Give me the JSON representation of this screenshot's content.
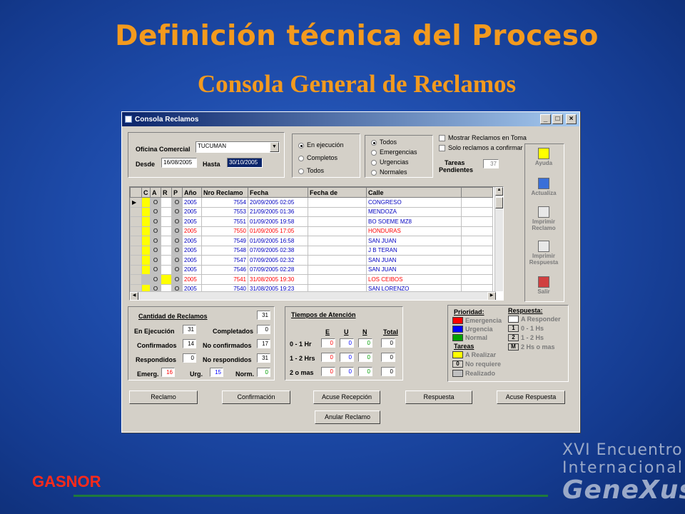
{
  "slide": {
    "title": "Definición técnica del Proceso",
    "subtitle": "Consola General de Reclamos",
    "footer_company": "GASNOR",
    "brand_line1": "XVI Encuentro",
    "brand_line2": "Internacional",
    "brand_line3": "GeneXus"
  },
  "window": {
    "title": "Consola Reclamos",
    "btn_min": "_",
    "btn_max": "□",
    "btn_close": "×"
  },
  "filters": {
    "oficina_label": "Oficina Comercial",
    "oficina_value": "TUCUMAN",
    "desde_label": "Desde",
    "desde_value": "16/08/2005",
    "hasta_label": "Hasta",
    "hasta_value": "30/10/2005",
    "estado_options": [
      "En ejecución",
      "Completos",
      "Todos"
    ],
    "tipo_options": [
      "Todos",
      "Emergencias",
      "Urgencias",
      "Normales"
    ],
    "chk_toma": "Mostrar Reclamos en Toma",
    "chk_confirmar": "Solo reclamos a confirmar",
    "tareas_label1": "Tareas",
    "tareas_label2": "Pendientes",
    "tareas_value": "37"
  },
  "side_buttons": [
    {
      "label1": "Ayuda",
      "label2": ""
    },
    {
      "label1": "Actualiza",
      "label2": ""
    },
    {
      "label1": "Imprimir",
      "label2": "Reclamo"
    },
    {
      "label1": "Imprimir",
      "label2": "Respuesta"
    },
    {
      "label1": "Salir",
      "label2": ""
    }
  ],
  "grid": {
    "headers": [
      "C",
      "A",
      "R",
      "P",
      "Año",
      "Nro Reclamo",
      "Fecha",
      "Fecha de",
      "Calle"
    ],
    "rows": [
      {
        "c": "#ffff00",
        "a": "O",
        "p": "O",
        "anio": "2005",
        "nro": "7554",
        "fecha": "20/09/2005 02:05",
        "calle": "CONGRESO",
        "color": "#0000c0"
      },
      {
        "c": "#ffff00",
        "a": "O",
        "p": "O",
        "anio": "2005",
        "nro": "7553",
        "fecha": "21/09/2005 01:36",
        "calle": "MENDOZA",
        "color": "#0000c0"
      },
      {
        "c": "#ffff00",
        "a": "O",
        "p": "O",
        "anio": "2005",
        "nro": "7551",
        "fecha": "01/09/2005 19:58",
        "calle": "BO SOEME MZ8",
        "color": "#0000c0"
      },
      {
        "c": "#ffff00",
        "a": "O",
        "p": "O",
        "anio": "2005",
        "nro": "7550",
        "fecha": "01/09/2005 17:05",
        "calle": "HONDURAS",
        "color": "#ff0000"
      },
      {
        "c": "#ffff00",
        "a": "O",
        "p": "O",
        "anio": "2005",
        "nro": "7549",
        "fecha": "01/09/2005 16:58",
        "calle": "SAN JUAN",
        "color": "#0000c0"
      },
      {
        "c": "#ffff00",
        "a": "O",
        "p": "O",
        "anio": "2005",
        "nro": "7548",
        "fecha": "07/09/2005 02:38",
        "calle": "J B TERAN",
        "color": "#0000c0"
      },
      {
        "c": "#ffff00",
        "a": "O",
        "p": "O",
        "anio": "2005",
        "nro": "7547",
        "fecha": "07/09/2005 02:32",
        "calle": "SAN JUAN",
        "color": "#0000c0"
      },
      {
        "c": "#ffff00",
        "a": "O",
        "p": "O",
        "anio": "2005",
        "nro": "7546",
        "fecha": "07/09/2005 02:28",
        "calle": "SAN JUAN",
        "color": "#0000c0"
      },
      {
        "c": "#c0c0c0",
        "a": "O",
        "p": "O",
        "anio": "2005",
        "nro": "7541",
        "fecha": "31/08/2005 19:30",
        "calle": "LOS CEIBOS",
        "color": "#ff0000",
        "r": "#ffff00"
      },
      {
        "c": "#ffff00",
        "a": "O",
        "p": "O",
        "anio": "2005",
        "nro": "7540",
        "fecha": "31/08/2005 19:23",
        "calle": "SAN LORENZO",
        "color": "#0000c0"
      }
    ]
  },
  "cantidad": {
    "title": "Cantidad de Reclamos",
    "total": "31",
    "en_ejecucion_label": "En Ejecución",
    "en_ejecucion": "31",
    "completados_label": "Completados",
    "completados": "0",
    "confirmados_label": "Confirmados",
    "confirmados": "14",
    "no_confirmados_label": "No confirmados",
    "no_confirmados": "17",
    "respondidos_label": "Respondidos",
    "respondidos": "0",
    "no_respondidos_label": "No respondidos",
    "no_respondidos": "31",
    "emerg_label": "Emerg.",
    "emerg": "16",
    "urg_label": "Urg.",
    "urg": "15",
    "norm_label": "Norm.",
    "norm": "0"
  },
  "tiempos": {
    "title": "Tiempos de Atención",
    "cols": [
      "E",
      "U",
      "N",
      "Total"
    ],
    "rows": [
      {
        "label": "0 - 1 Hr",
        "e": "0",
        "u": "0",
        "n": "0",
        "t": "0"
      },
      {
        "label": "1 - 2 Hrs",
        "e": "0",
        "u": "0",
        "n": "0",
        "t": "0"
      },
      {
        "label": "2 o mas",
        "e": "0",
        "u": "0",
        "n": "0",
        "t": "0"
      }
    ]
  },
  "leyenda": {
    "prioridad_title": "Prioridad:",
    "prioridad": [
      {
        "label": "Emergencia",
        "color": "#ff0000"
      },
      {
        "label": "Urgencia",
        "color": "#0000ff"
      },
      {
        "label": "Normal",
        "color": "#00a000"
      }
    ],
    "respuesta_title": "Respuesta:",
    "respuesta": [
      {
        "mark": "",
        "label": "A Responder"
      },
      {
        "mark": "1",
        "label": "0 - 1 Hs"
      },
      {
        "mark": "2",
        "label": "1 - 2 Hs"
      },
      {
        "mark": "M",
        "label": "2 Hs o mas"
      }
    ],
    "tareas_title": "Tareas",
    "tareas": [
      {
        "mark": "",
        "label": "A Realizar",
        "color": "#ffff00"
      },
      {
        "mark": "0",
        "label": "No requiere",
        "color": "#d4d0c8"
      },
      {
        "mark": "",
        "label": "Realizado",
        "color": "#c0c0c0"
      }
    ]
  },
  "actions": [
    "Reclamo",
    "Confirmación",
    "Acuse Recepción",
    "Respuesta",
    "Acuse Respuesta",
    "Anular Reclamo"
  ]
}
